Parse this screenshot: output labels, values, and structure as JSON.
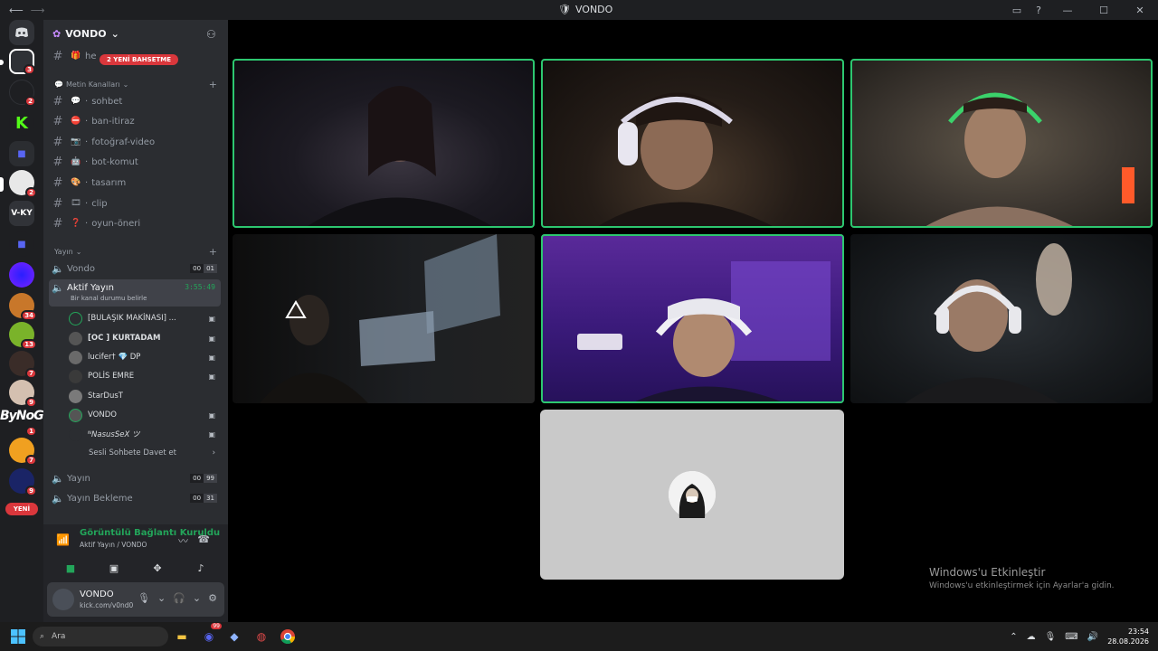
{
  "titlebar": {
    "app_title": "VONDO"
  },
  "servers": {
    "items": [
      {
        "label": "",
        "badge": "3"
      },
      {
        "label": "",
        "badge": "2"
      },
      {
        "label": "K",
        "badge": ""
      },
      {
        "label": "",
        "badge": ""
      },
      {
        "label": "",
        "badge": "2"
      },
      {
        "label": "V-KY",
        "badge": ""
      },
      {
        "label": "",
        "badge": ""
      },
      {
        "label": "",
        "badge": ""
      },
      {
        "label": "",
        "badge": "34"
      },
      {
        "label": "",
        "badge": "13"
      },
      {
        "label": "",
        "badge": "7"
      },
      {
        "label": "",
        "badge": "9"
      },
      {
        "label": "",
        "badge": "1"
      },
      {
        "label": "",
        "badge": "7"
      },
      {
        "label": "",
        "badge": "9"
      }
    ],
    "bynogame": "ByNoGame",
    "new_label": "YENİ"
  },
  "guild": {
    "name": "VONDO",
    "mention_pill": "2 YENİ BAHSETME",
    "first_channel": "he"
  },
  "text_category": "Metin Kanalları",
  "text_channels": [
    {
      "emoji": "💬",
      "name": "sohbet"
    },
    {
      "emoji": "⛔",
      "name": "ban-itiraz"
    },
    {
      "emoji": "📷",
      "name": "fotoğraf-video"
    },
    {
      "emoji": "🤖",
      "name": "bot-komut"
    },
    {
      "emoji": "🎨",
      "name": "tasarım"
    },
    {
      "emoji": "🎞",
      "name": "clip"
    },
    {
      "emoji": "❓",
      "name": "oyun-öneri"
    }
  ],
  "voice_category": "Yayın",
  "voice_channels": {
    "vondo": {
      "name": "Vondo",
      "count_a": "00",
      "count_b": "01"
    },
    "active": {
      "name": "Aktif Yayın",
      "timer": "3:55:49",
      "status": "Bir kanal durumu belirle"
    },
    "yayin": {
      "name": "Yayın",
      "count_a": "00",
      "count_b": "99"
    },
    "bekleme": {
      "name": "Yayın Bekleme",
      "count_a": "00",
      "count_b": "31"
    }
  },
  "members": [
    {
      "name": "[BULAŞIK MAKİNASI] ...",
      "cam": "▣"
    },
    {
      "name": "[OC  ] KURTADAM",
      "cam": "▣"
    },
    {
      "name": "lucifer†  💎 DP",
      "cam": "▣"
    },
    {
      "name": "POLİS EMRE",
      "cam": "▣"
    },
    {
      "name": "StarDusT",
      "cam": ""
    },
    {
      "name": "VONDO",
      "cam": "▣"
    },
    {
      "name": "ᴺNasusSeX ツ",
      "cam": "▣"
    }
  ],
  "invite": {
    "label": "Sesli Sohbete Davet et",
    "chevron": "›"
  },
  "connection": {
    "title": "Görüntülü Bağlantı Kuruldu",
    "subtitle": "Aktif Yayın / VONDO"
  },
  "user": {
    "name": "VONDO",
    "status": "kick.com/v0nd0"
  },
  "watermark": {
    "line1": "Windows'u Etkinleştir",
    "line2": "Windows'u etkinleştirmek için Ayarlar'a gidin."
  },
  "taskbar": {
    "search_placeholder": "Ara",
    "discord_badge": "99",
    "time": "23:54",
    "date": "28.08.2026"
  },
  "colors": {
    "speaking": "#2dc770",
    "accent": "#23a55a",
    "danger": "#da373c"
  }
}
